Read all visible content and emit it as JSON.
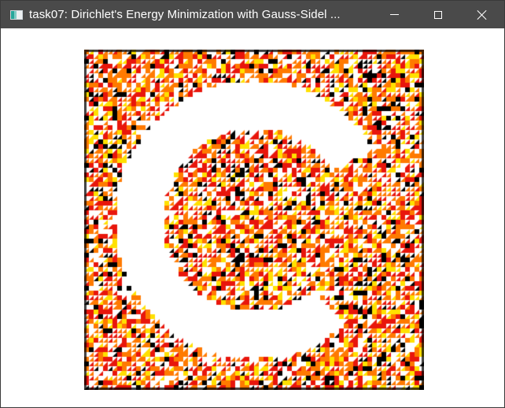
{
  "window": {
    "title": "task07: Dirichlet's Energy Minimization with Gauss-Sidel ...",
    "icon": "app-window-icon",
    "controls": {
      "minimize_icon": "minimize-icon",
      "maximize_icon": "maximize-icon",
      "close_icon": "close-icon"
    }
  },
  "viewport": {
    "description_icon": "opengl-render-canvas",
    "colors": {
      "black": "#000000",
      "red": "#e8160c",
      "orange": "#ff7a00",
      "yellow": "#ffe000",
      "white": "#ffffff"
    }
  }
}
